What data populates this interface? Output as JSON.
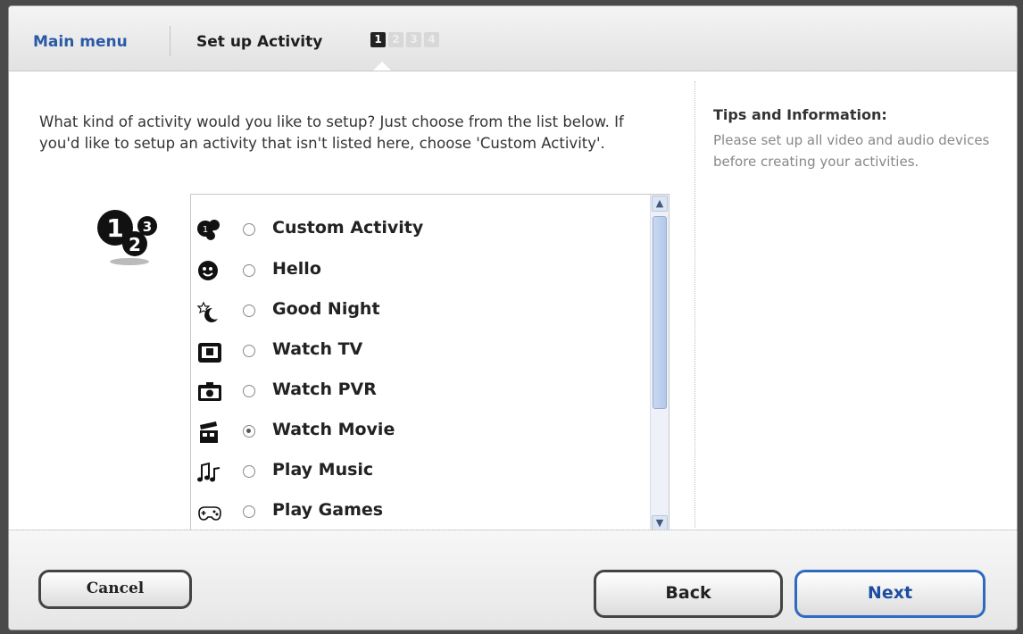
{
  "header": {
    "main_menu": "Main menu",
    "current": "Set up Activity",
    "steps": [
      "1",
      "2",
      "3",
      "4"
    ]
  },
  "intro": "What kind of activity would you like to setup? Just choose from the list below. If you'd like to setup an activity that isn't listed here, choose 'Custom Activity'.",
  "activities": [
    {
      "label": "Custom Activity",
      "icon": "custom-activity-icon",
      "selected": false
    },
    {
      "label": "Hello",
      "icon": "hello-icon",
      "selected": false
    },
    {
      "label": "Good Night",
      "icon": "good-night-icon",
      "selected": false
    },
    {
      "label": "Watch TV",
      "icon": "tv-icon",
      "selected": false
    },
    {
      "label": "Watch PVR",
      "icon": "pvr-icon",
      "selected": false
    },
    {
      "label": "Watch Movie",
      "icon": "movie-icon",
      "selected": true
    },
    {
      "label": "Play Music",
      "icon": "music-icon",
      "selected": false
    },
    {
      "label": "Play Games",
      "icon": "games-icon",
      "selected": false
    }
  ],
  "tips": {
    "title": "Tips and Information:",
    "text": "Please set up all video and audio devices before creating your activities."
  },
  "buttons": {
    "cancel": "Cancel",
    "back": "Back",
    "next": "Next"
  },
  "colors": {
    "link": "#2a5aa8",
    "next_border": "#2e6ac1"
  }
}
